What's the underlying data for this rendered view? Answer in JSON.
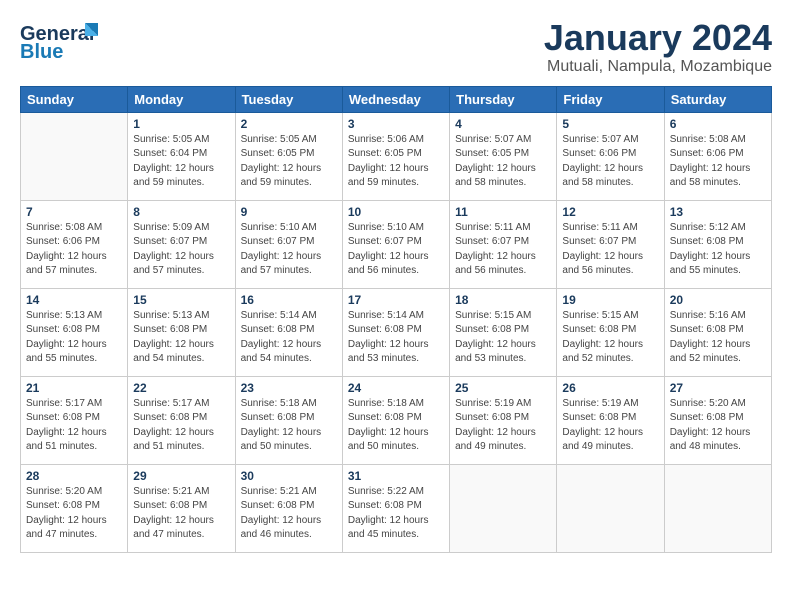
{
  "header": {
    "logo_line1": "General",
    "logo_line2": "Blue",
    "title": "January 2024",
    "subtitle": "Mutuali, Nampula, Mozambique"
  },
  "columns": [
    "Sunday",
    "Monday",
    "Tuesday",
    "Wednesday",
    "Thursday",
    "Friday",
    "Saturday"
  ],
  "weeks": [
    [
      {
        "day": "",
        "info": ""
      },
      {
        "day": "1",
        "info": "Sunrise: 5:05 AM\nSunset: 6:04 PM\nDaylight: 12 hours\nand 59 minutes."
      },
      {
        "day": "2",
        "info": "Sunrise: 5:05 AM\nSunset: 6:05 PM\nDaylight: 12 hours\nand 59 minutes."
      },
      {
        "day": "3",
        "info": "Sunrise: 5:06 AM\nSunset: 6:05 PM\nDaylight: 12 hours\nand 59 minutes."
      },
      {
        "day": "4",
        "info": "Sunrise: 5:07 AM\nSunset: 6:05 PM\nDaylight: 12 hours\nand 58 minutes."
      },
      {
        "day": "5",
        "info": "Sunrise: 5:07 AM\nSunset: 6:06 PM\nDaylight: 12 hours\nand 58 minutes."
      },
      {
        "day": "6",
        "info": "Sunrise: 5:08 AM\nSunset: 6:06 PM\nDaylight: 12 hours\nand 58 minutes."
      }
    ],
    [
      {
        "day": "7",
        "info": "Sunrise: 5:08 AM\nSunset: 6:06 PM\nDaylight: 12 hours\nand 57 minutes."
      },
      {
        "day": "8",
        "info": "Sunrise: 5:09 AM\nSunset: 6:07 PM\nDaylight: 12 hours\nand 57 minutes."
      },
      {
        "day": "9",
        "info": "Sunrise: 5:10 AM\nSunset: 6:07 PM\nDaylight: 12 hours\nand 57 minutes."
      },
      {
        "day": "10",
        "info": "Sunrise: 5:10 AM\nSunset: 6:07 PM\nDaylight: 12 hours\nand 56 minutes."
      },
      {
        "day": "11",
        "info": "Sunrise: 5:11 AM\nSunset: 6:07 PM\nDaylight: 12 hours\nand 56 minutes."
      },
      {
        "day": "12",
        "info": "Sunrise: 5:11 AM\nSunset: 6:07 PM\nDaylight: 12 hours\nand 56 minutes."
      },
      {
        "day": "13",
        "info": "Sunrise: 5:12 AM\nSunset: 6:08 PM\nDaylight: 12 hours\nand 55 minutes."
      }
    ],
    [
      {
        "day": "14",
        "info": "Sunrise: 5:13 AM\nSunset: 6:08 PM\nDaylight: 12 hours\nand 55 minutes."
      },
      {
        "day": "15",
        "info": "Sunrise: 5:13 AM\nSunset: 6:08 PM\nDaylight: 12 hours\nand 54 minutes."
      },
      {
        "day": "16",
        "info": "Sunrise: 5:14 AM\nSunset: 6:08 PM\nDaylight: 12 hours\nand 54 minutes."
      },
      {
        "day": "17",
        "info": "Sunrise: 5:14 AM\nSunset: 6:08 PM\nDaylight: 12 hours\nand 53 minutes."
      },
      {
        "day": "18",
        "info": "Sunrise: 5:15 AM\nSunset: 6:08 PM\nDaylight: 12 hours\nand 53 minutes."
      },
      {
        "day": "19",
        "info": "Sunrise: 5:15 AM\nSunset: 6:08 PM\nDaylight: 12 hours\nand 52 minutes."
      },
      {
        "day": "20",
        "info": "Sunrise: 5:16 AM\nSunset: 6:08 PM\nDaylight: 12 hours\nand 52 minutes."
      }
    ],
    [
      {
        "day": "21",
        "info": "Sunrise: 5:17 AM\nSunset: 6:08 PM\nDaylight: 12 hours\nand 51 minutes."
      },
      {
        "day": "22",
        "info": "Sunrise: 5:17 AM\nSunset: 6:08 PM\nDaylight: 12 hours\nand 51 minutes."
      },
      {
        "day": "23",
        "info": "Sunrise: 5:18 AM\nSunset: 6:08 PM\nDaylight: 12 hours\nand 50 minutes."
      },
      {
        "day": "24",
        "info": "Sunrise: 5:18 AM\nSunset: 6:08 PM\nDaylight: 12 hours\nand 50 minutes."
      },
      {
        "day": "25",
        "info": "Sunrise: 5:19 AM\nSunset: 6:08 PM\nDaylight: 12 hours\nand 49 minutes."
      },
      {
        "day": "26",
        "info": "Sunrise: 5:19 AM\nSunset: 6:08 PM\nDaylight: 12 hours\nand 49 minutes."
      },
      {
        "day": "27",
        "info": "Sunrise: 5:20 AM\nSunset: 6:08 PM\nDaylight: 12 hours\nand 48 minutes."
      }
    ],
    [
      {
        "day": "28",
        "info": "Sunrise: 5:20 AM\nSunset: 6:08 PM\nDaylight: 12 hours\nand 47 minutes."
      },
      {
        "day": "29",
        "info": "Sunrise: 5:21 AM\nSunset: 6:08 PM\nDaylight: 12 hours\nand 47 minutes."
      },
      {
        "day": "30",
        "info": "Sunrise: 5:21 AM\nSunset: 6:08 PM\nDaylight: 12 hours\nand 46 minutes."
      },
      {
        "day": "31",
        "info": "Sunrise: 5:22 AM\nSunset: 6:08 PM\nDaylight: 12 hours\nand 45 minutes."
      },
      {
        "day": "",
        "info": ""
      },
      {
        "day": "",
        "info": ""
      },
      {
        "day": "",
        "info": ""
      }
    ]
  ]
}
